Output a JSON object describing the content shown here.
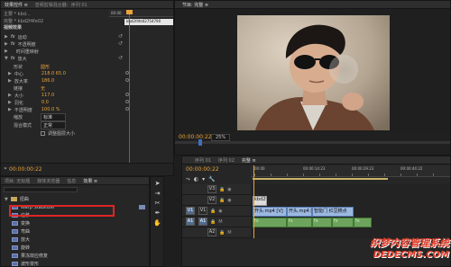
{
  "effect_controls": {
    "tabs": [
      {
        "label": "效果控件 ≡",
        "active": true
      },
      {
        "label": "音频剪辑混合器：序列 01",
        "active": false
      }
    ],
    "source_label": "主要 * kbd...",
    "sequence_label": "完整 * kbd2f4fe02",
    "video_effects_header": "视频效果",
    "ruler_time": "00:00",
    "clip_bar_label": "kbd2f4fe02754790",
    "rows": [
      {
        "fx": "fx",
        "label": "运动"
      },
      {
        "fx": "fx",
        "label": "不透明度"
      },
      {
        "fx": "",
        "label": "时间重映射"
      },
      {
        "fx": "fx",
        "label": "放大"
      },
      {
        "label": "形状",
        "value": "圆形"
      },
      {
        "label": "中心",
        "value": "218.0   65.0"
      },
      {
        "label": "放大率",
        "value": "186.0"
      },
      {
        "label": "链接",
        "value": "无"
      },
      {
        "label": "大小",
        "value": "117.0"
      },
      {
        "label": "羽化",
        "value": "0.0"
      },
      {
        "label": "不透明度",
        "value": "100.0 %"
      },
      {
        "label": "缩放",
        "value": "标准"
      },
      {
        "label": "混合模式",
        "value": "正常"
      },
      {
        "label": "调整图层大小",
        "value": ""
      }
    ],
    "timecode": "00:00:00:22"
  },
  "program_monitor": {
    "tabs": [
      {
        "label": "节目: 完整 ≡",
        "active": true
      }
    ],
    "timecode_left": "00:00:00:22",
    "zoom": "25%",
    "transport": [
      "◆",
      "{",
      "}",
      "|◀",
      "◀",
      "▶",
      "▶|",
      "⇥",
      "⇤",
      "▣",
      "⊡",
      "+"
    ]
  },
  "project_panel": {
    "tabs": [
      {
        "label": "项目: 无标题",
        "active": false
      },
      {
        "label": "媒体浏览器",
        "active": false
      },
      {
        "label": "信息",
        "active": false
      },
      {
        "label": "效果 ≡",
        "active": true
      }
    ],
    "items": [
      {
        "kind": "folder",
        "label": "扭曲"
      },
      {
        "kind": "fx",
        "label": "Warp Stabilizer"
      },
      {
        "kind": "fx",
        "label": "位移"
      },
      {
        "kind": "fx",
        "label": "变换"
      },
      {
        "kind": "fx",
        "label": "弯曲"
      },
      {
        "kind": "fx",
        "label": "放大"
      },
      {
        "kind": "fx",
        "label": "旋转"
      },
      {
        "kind": "fx",
        "label": "果冻效应修复"
      },
      {
        "kind": "fx",
        "label": "波形变形"
      }
    ]
  },
  "timeline": {
    "tabs": [
      {
        "label": "序列 01",
        "active": false
      },
      {
        "label": "序列 02",
        "active": false
      },
      {
        "label": "完整 ≡",
        "active": true
      }
    ],
    "timecode": "00:00:00:22",
    "ruler_labels": [
      "00:00",
      "00:00:14:23",
      "00:00:29:23",
      "00:00:44:22"
    ],
    "tracks": [
      {
        "name": "V3",
        "on": false
      },
      {
        "name": "V2",
        "on": false
      },
      {
        "name": "V1",
        "on": true
      },
      {
        "name": "A1",
        "on": true
      },
      {
        "name": "A2",
        "on": false
      }
    ],
    "clips": {
      "v2": "kbd2f4",
      "v1": [
        "开头.mp4 [V]",
        "开头.mp4 [V]",
        "智能门 红豆糕点"
      ],
      "a1_markers": [
        "fx",
        "fx",
        "fx",
        "fx",
        "fx"
      ]
    }
  },
  "watermark": {
    "line1": "织梦内容管理系统",
    "line2": "DEDECMS.COM"
  }
}
